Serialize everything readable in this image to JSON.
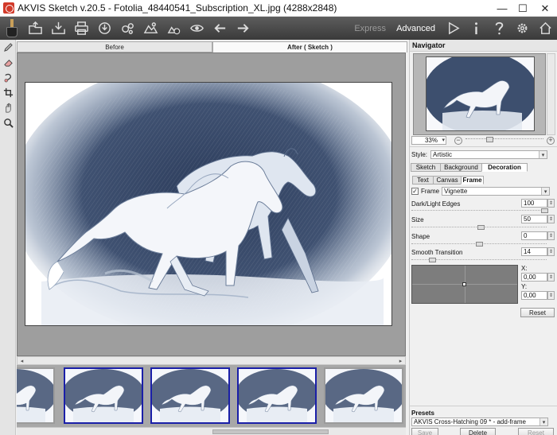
{
  "window": {
    "title": "AKVIS Sketch v.20.5 - Fotolia_48440541_Subscription_XL.jpg (4288x2848)",
    "minimize": "—",
    "maximize": "☐",
    "close": "✕"
  },
  "toolbar": {
    "buttons": [
      "open-icon",
      "save-icon",
      "print-icon",
      "share-icon",
      "batch-icon",
      "plugin-settings-icon",
      "export-icon",
      "preview-icon",
      "undo-icon",
      "redo-icon"
    ],
    "mode_express": "Express",
    "mode_advanced": "Advanced",
    "right_buttons": [
      "run-icon",
      "info-icon",
      "help-icon",
      "settings-icon"
    ]
  },
  "left_tools": [
    "pencil-icon",
    "eraser-icon",
    "smudge-icon",
    "crop-icon",
    "hand-icon",
    "zoom-icon"
  ],
  "view_tabs": {
    "before": "Before",
    "after": "After ( Sketch )"
  },
  "navigator": {
    "title": "Navigator",
    "zoom": "33%",
    "zoom_minus": "−",
    "zoom_plus": "+"
  },
  "style": {
    "label": "Style:",
    "value": "Artistic"
  },
  "main_tabs": [
    "Sketch",
    "Background",
    "Decoration"
  ],
  "main_active": "Decoration",
  "sub_tabs": [
    "Text",
    "Canvas",
    "Frame"
  ],
  "sub_active": "Frame",
  "frame": {
    "checkbox_label": "Frame",
    "checked": "✓",
    "type": "Vignette"
  },
  "params": [
    {
      "label": "Dark/Light Edges",
      "value": "100"
    },
    {
      "label": "Size",
      "value": "50"
    },
    {
      "label": "Shape",
      "value": "0"
    },
    {
      "label": "Smooth Transition",
      "value": "14"
    }
  ],
  "position": {
    "x_label": "X:",
    "x_value": "0,00",
    "y_label": "Y:",
    "y_value": "0,00",
    "reset": "Reset"
  },
  "presets": {
    "title": "Presets",
    "value": "AKVIS Cross-Hatching 09 * - add-frame",
    "save": "Save",
    "delete": "Delete",
    "reset": "Reset"
  },
  "colors": {
    "toolbar_dark": "#3a3a3a",
    "canvas_gray": "#9e9e9e",
    "selected_thumb": "#1a1fa8",
    "sketch_blue": "#3d4f6e"
  }
}
